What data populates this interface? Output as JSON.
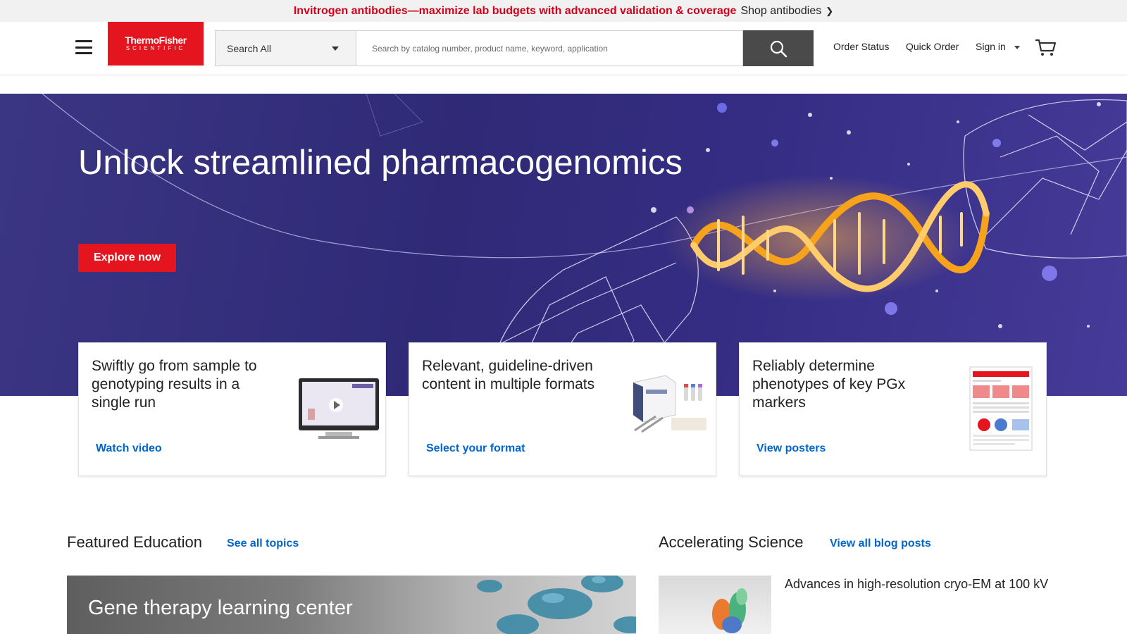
{
  "promo": {
    "headline": "Invitrogen antibodies—maximize lab budgets with advanced validation & coverage",
    "link": "Shop antibodies",
    "chevron": "❯"
  },
  "header": {
    "logo_line1": "ThermoFisher",
    "logo_line2": "SCIENTIFIC",
    "search_category": "Search All",
    "search_placeholder": "Search by catalog number, product name, keyword, application",
    "order_status": "Order Status",
    "quick_order": "Quick Order",
    "sign_in": "Sign in"
  },
  "hero": {
    "title": "Unlock streamlined pharmacogenomics",
    "cta": "Explore now"
  },
  "cards": [
    {
      "text": "Swiftly go from sample to genotyping results in a single run",
      "link": "Watch video",
      "image": "monitor-video-thumbnail"
    },
    {
      "text": "Relevant, guideline-driven content in multiple formats",
      "link": "Select your format",
      "image": "assay-kit-products"
    },
    {
      "text": "Reliably determine phenotypes of key PGx markers",
      "link": "View posters",
      "image": "poster-thumbnail"
    }
  ],
  "featured_education": {
    "title": "Featured Education",
    "link": "See all topics",
    "banner_title": "Gene therapy learning center"
  },
  "accelerating_science": {
    "title": "Accelerating Science",
    "link": "View all blog posts",
    "post_title": "Advances in high-resolution cryo-EM at 100 kV"
  },
  "colors": {
    "brand_red": "#e4151f",
    "link_blue": "#0066cc",
    "hero_bg": "#2f2a76",
    "dna_orange": "#f39a1e"
  }
}
